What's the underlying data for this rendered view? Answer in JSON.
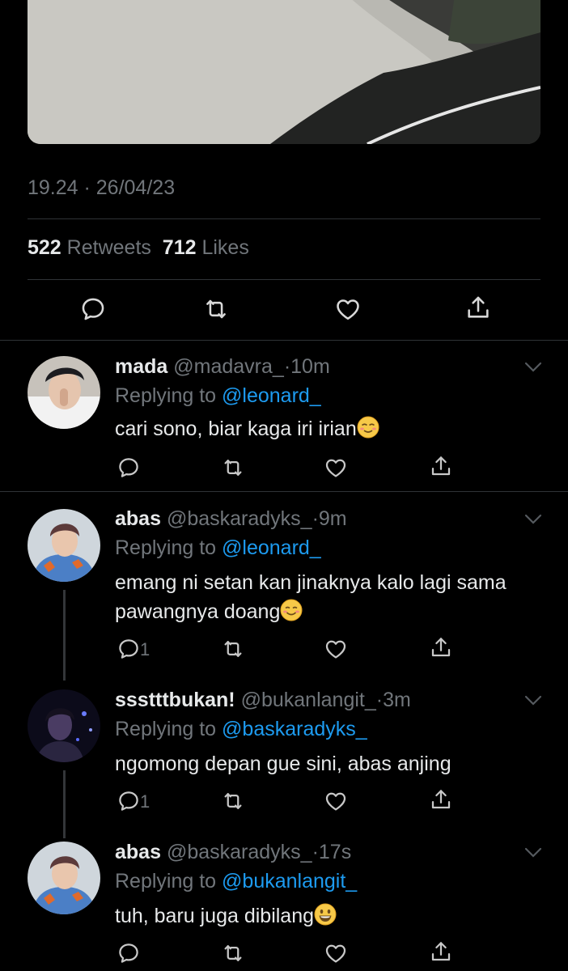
{
  "tweet": {
    "time": "19.24 · 26/04/23",
    "retweets_count": "522",
    "retweets_label": "Retweets",
    "likes_count": "712",
    "likes_label": "Likes"
  },
  "replies": [
    {
      "name": "mada",
      "handle": "@madavra_",
      "age": "·10m",
      "replying_prefix": "Replying to",
      "replying_to": "@leonard_",
      "text": "cari sono, biar kaga iri irian",
      "emoji": "relieved-face",
      "reply_count": ""
    },
    {
      "name": "abas",
      "handle": "@baskaradyks_",
      "age": "·9m",
      "replying_prefix": "Replying to",
      "replying_to": "@leonard_",
      "text_line1": "emang ni setan kan jinaknya kalo lagi sama",
      "text_line2": "pawangnya doang",
      "emoji": "smiling-face",
      "reply_count": "1"
    },
    {
      "name": "ssstttbukan!",
      "handle": "@bukanlangit_",
      "age": "·3m",
      "replying_prefix": "Replying to",
      "replying_to": "@baskaradyks_",
      "text": "ngomong depan gue sini, abas anjing",
      "reply_count": "1"
    },
    {
      "name": "abas",
      "handle": "@baskaradyks_",
      "age": "·17s",
      "replying_prefix": "Replying to",
      "replying_to": "@bukanlangit_",
      "text": "tuh, baru juga dibilang",
      "emoji": "grinning-face",
      "reply_count": ""
    }
  ],
  "colors": {
    "background": "#000000",
    "text": "#e7e9ea",
    "secondary": "#71767b",
    "link": "#1d9bf0",
    "divider": "#2f3336"
  }
}
